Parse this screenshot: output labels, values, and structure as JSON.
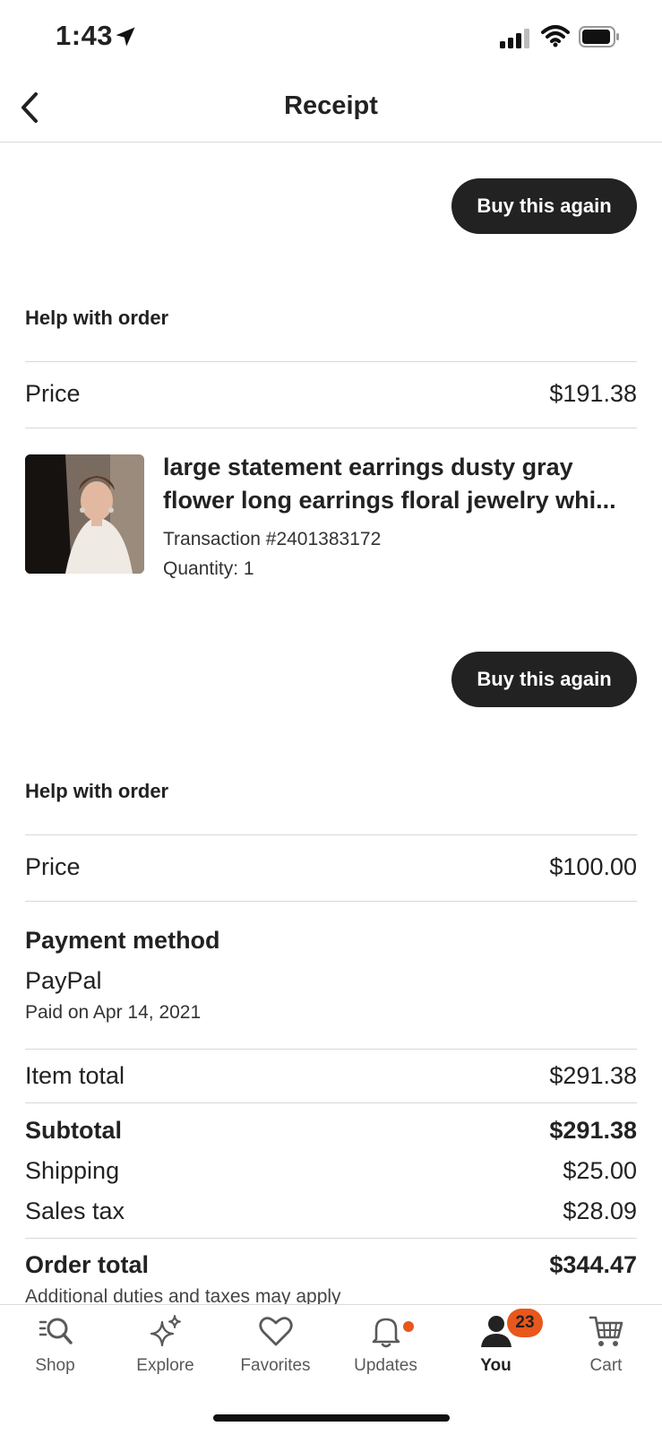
{
  "status_bar": {
    "time": "1:43"
  },
  "nav": {
    "title": "Receipt"
  },
  "orders": [
    {
      "buy_again_label": "Buy this again",
      "help_label": "Help with order",
      "price_label": "Price",
      "price_value": "$191.38",
      "item": {
        "title": "large statement earrings dusty gray flower long earrings floral jewelry whi...",
        "transaction": "Transaction #2401383172",
        "quantity": "Quantity: 1"
      }
    },
    {
      "buy_again_label": "Buy this again",
      "help_label": "Help with order",
      "price_label": "Price",
      "price_value": "$100.00"
    }
  ],
  "payment": {
    "heading": "Payment method",
    "method": "PayPal",
    "paid_on": "Paid on Apr 14, 2021"
  },
  "totals": {
    "item_total_label": "Item total",
    "item_total_value": "$291.38",
    "subtotal_label": "Subtotal",
    "subtotal_value": "$291.38",
    "shipping_label": "Shipping",
    "shipping_value": "$25.00",
    "sales_tax_label": "Sales tax",
    "sales_tax_value": "$28.09",
    "order_total_label": "Order total",
    "order_total_value": "$344.47",
    "note": "Additional duties and taxes may apply"
  },
  "tabbar": {
    "shop": "Shop",
    "explore": "Explore",
    "favorites": "Favorites",
    "updates": "Updates",
    "you": "You",
    "you_badge": "23",
    "cart": "Cart"
  },
  "colors": {
    "accent": "#e8571b",
    "button": "#222222"
  }
}
